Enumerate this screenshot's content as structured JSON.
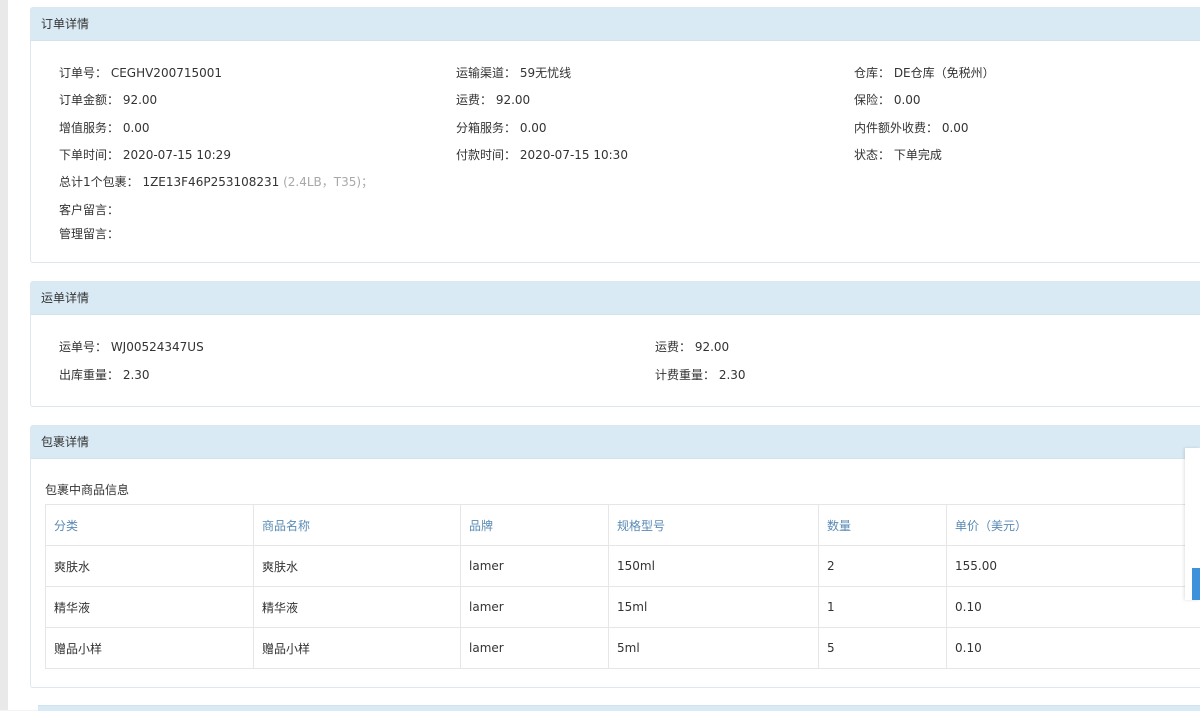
{
  "order_panel": {
    "title": "订单详情",
    "order_no": "订单号： CEGHV200715001",
    "channel": "运输渠道： 59无忧线",
    "warehouse": "仓库： DE仓库（免税州）",
    "amount": "订单金额： 92.00",
    "freight": "运费： 92.00",
    "insurance": "保险： 0.00",
    "value_added": "增值服务： 0.00",
    "split_service": "分箱服务： 0.00",
    "extra_fee": "内件额外收费： 0.00",
    "order_time": "下单时间： 2020-07-15 10:29",
    "pay_time": "付款时间： 2020-07-15 10:30",
    "status": "状态： 下单完成",
    "package_summary": "总计1个包裹： 1ZE13F46P253108231",
    "package_meta": "(2.4LB，T35)；",
    "customer_note": "客户留言：",
    "admin_note": "管理留言："
  },
  "waybill_panel": {
    "title": "运单详情",
    "waybill_no": "运单号： WJ00524347US",
    "freight": "运费： 92.00",
    "out_weight": "出库重量： 2.30",
    "bill_weight": "计费重量： 2.30"
  },
  "package_panel": {
    "title": "包裹详情",
    "subtitle": "包裹中商品信息",
    "columns": [
      "分类",
      "商品名称",
      "品牌",
      "规格型号",
      "数量",
      "单价（美元）"
    ],
    "rows": [
      [
        "爽肤水",
        "爽肤水",
        "lamer",
        "150ml",
        "2",
        "155.00"
      ],
      [
        "精华液",
        "精华液",
        "lamer",
        "15ml",
        "1",
        "0.10"
      ],
      [
        "赠品小样",
        "赠品小样",
        "lamer",
        "5ml",
        "5",
        "0.10"
      ]
    ]
  },
  "colors": {
    "panel_header_bg": "#d9eaf5",
    "table_header_text": "#5a8ab5",
    "side_tab_accent": "#3e92dc"
  }
}
